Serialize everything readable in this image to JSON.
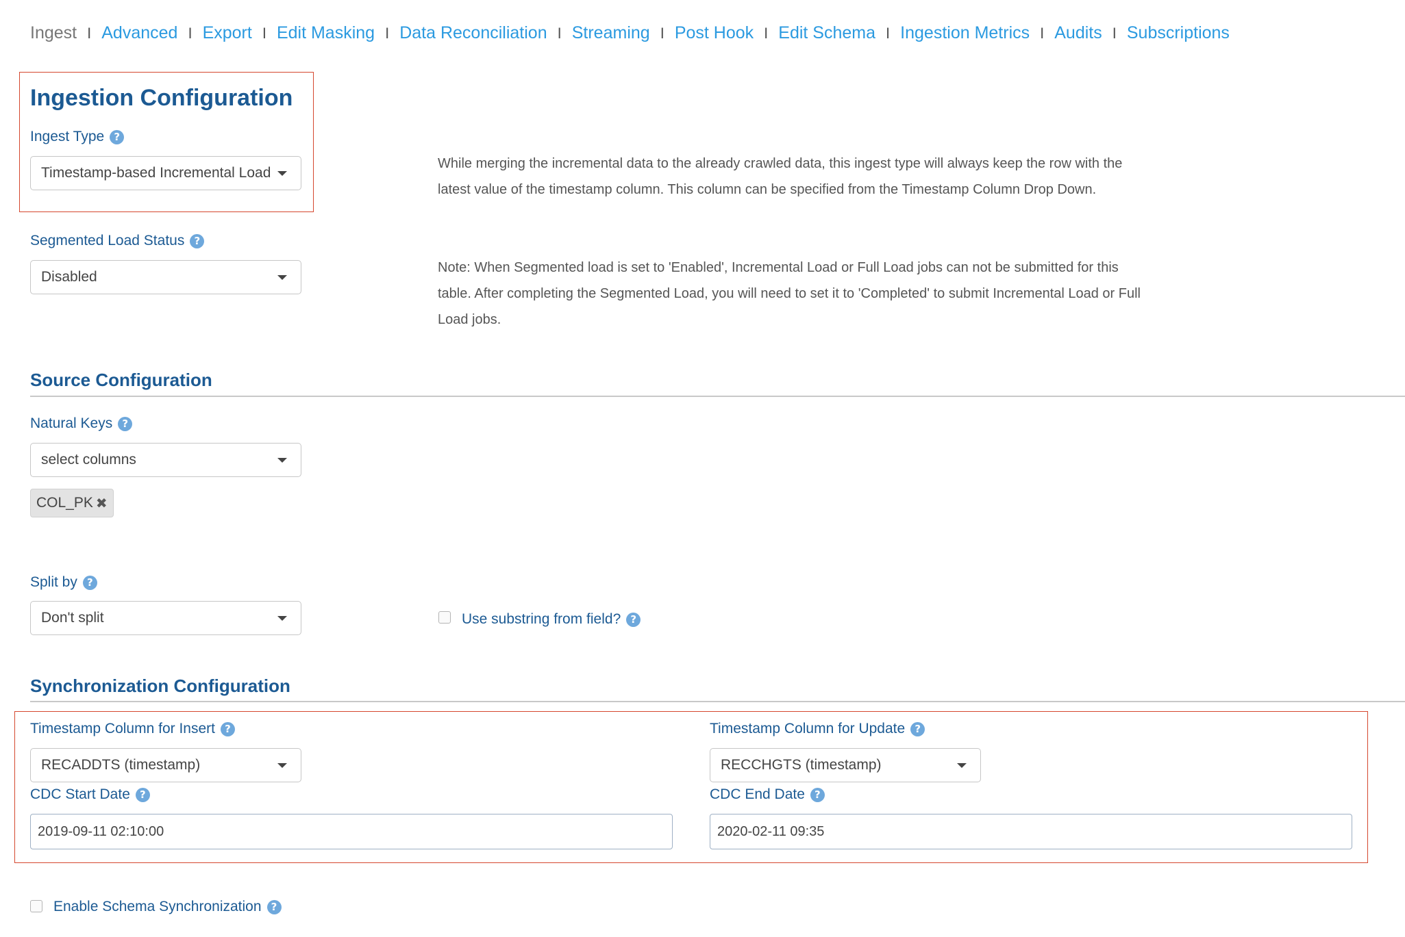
{
  "nav": {
    "items": [
      "Ingest",
      "Advanced",
      "Export",
      "Edit Masking",
      "Data Reconciliation",
      "Streaming",
      "Post Hook",
      "Edit Schema",
      "Ingestion Metrics",
      "Audits",
      "Subscriptions"
    ],
    "active": "Ingest",
    "separator": "I"
  },
  "ingestion": {
    "title": "Ingestion Configuration",
    "ingest_type_label": "Ingest Type",
    "ingest_type_value": "Timestamp-based Incremental Load",
    "ingest_type_description_line1": "While merging the incremental data to the already crawled data, this ingest type will always keep the row with the",
    "ingest_type_description_line2": "latest value of the timestamp column. This column can be specified from the Timestamp Column Drop Down.",
    "segmented_label": "Segmented Load Status",
    "segmented_value": "Disabled",
    "segmented_note_line1": "Note: When Segmented load is set to 'Enabled', Incremental Load or Full Load jobs can not be submitted for this",
    "segmented_note_line2": "table. After completing the Segmented Load, you will need to set it to 'Completed' to submit Incremental Load or Full",
    "segmented_note_line3": "Load jobs."
  },
  "source": {
    "title": "Source Configuration",
    "natural_keys_label": "Natural Keys",
    "natural_keys_placeholder": "select columns",
    "natural_keys_tag": "COL_PK",
    "split_by_label": "Split by",
    "split_by_value": "Don't split",
    "substring_label": "Use substring from field?"
  },
  "sync": {
    "title": "Synchronization Configuration",
    "ts_insert_label": "Timestamp Column for Insert",
    "ts_insert_value": "RECADDTS (timestamp)",
    "ts_update_label": "Timestamp Column for Update",
    "ts_update_value": "RECCHGTS (timestamp)",
    "cdc_start_label": "CDC Start Date",
    "cdc_start_value": "2019-09-11 02:10:00",
    "cdc_end_label": "CDC End Date",
    "cdc_end_value": "2020-02-11 09:35"
  },
  "schema_sync_label": "Enable Schema Synchronization",
  "help_glyph": "?",
  "remove_glyph": "✖",
  "colors": {
    "link": "#2b9ae0",
    "heading": "#1c5a93",
    "highlight_border": "#d5472e",
    "help_icon": "#6ea8dc"
  }
}
